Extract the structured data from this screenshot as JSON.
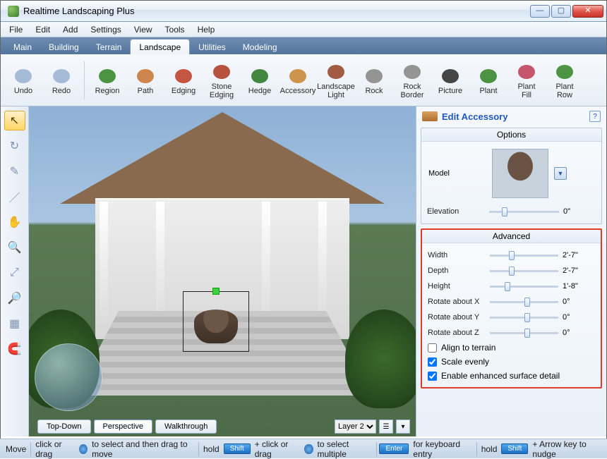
{
  "window": {
    "title": "Realtime Landscaping Plus"
  },
  "menu": [
    "File",
    "Edit",
    "Add",
    "Settings",
    "View",
    "Tools",
    "Help"
  ],
  "tabs": {
    "items": [
      "Main",
      "Building",
      "Terrain",
      "Landscape",
      "Utilities",
      "Modeling"
    ],
    "active": "Landscape"
  },
  "ribbon": [
    {
      "label": "Undo",
      "icon": "undo-icon"
    },
    {
      "label": "Redo",
      "icon": "redo-icon"
    },
    {
      "sep": true
    },
    {
      "label": "Region",
      "icon": "region-icon"
    },
    {
      "label": "Path",
      "icon": "path-icon"
    },
    {
      "label": "Edging",
      "icon": "edging-icon"
    },
    {
      "label": "Stone\nEdging",
      "icon": "stone-edging-icon"
    },
    {
      "label": "Hedge",
      "icon": "hedge-icon"
    },
    {
      "label": "Accessory",
      "icon": "accessory-icon"
    },
    {
      "label": "Landscape\nLight",
      "icon": "landscape-light-icon"
    },
    {
      "label": "Rock",
      "icon": "rock-icon"
    },
    {
      "label": "Rock\nBorder",
      "icon": "rock-border-icon"
    },
    {
      "label": "Picture",
      "icon": "picture-icon"
    },
    {
      "label": "Plant",
      "icon": "plant-icon"
    },
    {
      "label": "Plant\nFill",
      "icon": "plant-fill-icon"
    },
    {
      "label": "Plant\nRow",
      "icon": "plant-row-icon"
    }
  ],
  "leftTools": [
    {
      "name": "select-tool",
      "active": true,
      "glyph": "↖"
    },
    {
      "name": "orbit-tool",
      "glyph": "↻"
    },
    {
      "name": "edit-points-tool",
      "glyph": "✎"
    },
    {
      "name": "line-tool",
      "glyph": "／"
    },
    {
      "name": "pan-tool",
      "glyph": "✋"
    },
    {
      "name": "zoom-in-tool",
      "glyph": "🔍"
    },
    {
      "name": "zoom-extents-tool",
      "glyph": "⤢"
    },
    {
      "name": "zoom-selection-tool",
      "glyph": "🔎"
    },
    {
      "name": "grid-tool",
      "glyph": "▦"
    },
    {
      "name": "snap-tool",
      "glyph": "🧲"
    }
  ],
  "viewTabs": {
    "items": [
      "Top-Down",
      "Perspective",
      "Walkthrough"
    ],
    "active": "Perspective"
  },
  "layer": {
    "current": "Layer 2"
  },
  "panel": {
    "title": "Edit Accessory",
    "sections": {
      "options": {
        "header": "Options",
        "modelLabel": "Model",
        "elevation": {
          "label": "Elevation",
          "value": "0\"",
          "pos": 18
        }
      },
      "advanced": {
        "header": "Advanced",
        "sliders": [
          {
            "label": "Width",
            "value": "2'-7\"",
            "pos": 28
          },
          {
            "label": "Depth",
            "value": "2'-7\"",
            "pos": 28
          },
          {
            "label": "Height",
            "value": "1'-8\"",
            "pos": 22
          },
          {
            "label": "Rotate about X",
            "value": "0°",
            "pos": 50
          },
          {
            "label": "Rotate about Y",
            "value": "0°",
            "pos": 50
          },
          {
            "label": "Rotate about Z",
            "value": "0°",
            "pos": 50
          }
        ],
        "checks": [
          {
            "label": "Align to terrain",
            "checked": false
          },
          {
            "label": "Scale evenly",
            "checked": true
          },
          {
            "label": "Enable enhanced surface detail",
            "checked": true
          }
        ]
      }
    }
  },
  "status": {
    "mode": "Move",
    "hint1": "click or drag",
    "hint2": "to select and then drag to move",
    "hold": "hold",
    "shift": "Shift",
    "plus": "+ click or drag",
    "hint3": "to select multiple",
    "enter": "Enter",
    "hint4": "for keyboard entry",
    "hint5": "+ Arrow key to nudge"
  }
}
